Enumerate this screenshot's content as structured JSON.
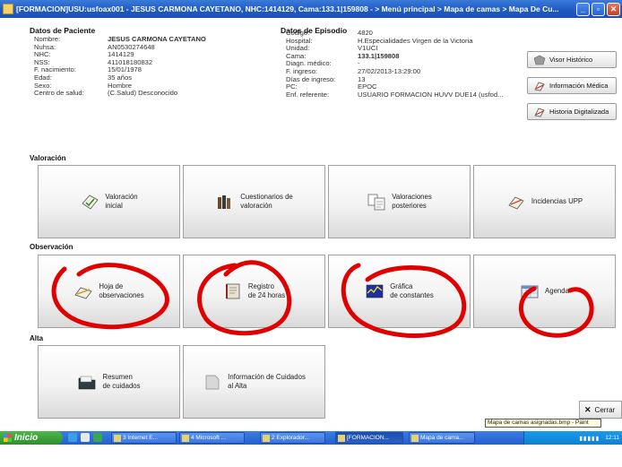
{
  "window": {
    "title": "[FORMACION]USU:usfoax001 - JESUS CARMONA CAYETANO, NHC:1414129, Cama:133.1|159808 - > Menú principal > Mapa de camas > Mapa De Cu...",
    "min_symbol": "_",
    "max_symbol": "▫",
    "close_symbol": "✕"
  },
  "patient": {
    "heading": "Datos de Paciente",
    "fields": [
      {
        "label": "Nombre:",
        "value": "JESUS CARMONA CAYETANO",
        "bold": true
      },
      {
        "label": "Nuhsa:",
        "value": "AN0530274648"
      },
      {
        "label": "NHC:",
        "value": "1414129"
      },
      {
        "label": "NSS:",
        "value": "411018180832"
      },
      {
        "label": "F. nacimiento:",
        "value": "15/01/1978"
      },
      {
        "label": "Edad:",
        "value": "35 años"
      },
      {
        "label": "Sexo:",
        "value": "Hombre"
      },
      {
        "label": "Centro de salud:",
        "value": "(C.Salud) Desconocido"
      }
    ]
  },
  "episode": {
    "heading": "Datos de Episodio",
    "fields": [
      {
        "label": "Codigo:",
        "value": "4820"
      },
      {
        "label": "Hospital:",
        "value": "H.Especialidades Virgen de la Victoria"
      },
      {
        "label": "Unidad:",
        "value": "V1UCI"
      },
      {
        "label": "Cama:",
        "value": "133.1|159808",
        "bold": true
      },
      {
        "label": "Diagn. médico:",
        "value": "-"
      },
      {
        "label": "F. ingreso:",
        "value": "27/02/2013-13:29:00"
      },
      {
        "label": "Días de ingreso:",
        "value": "13"
      },
      {
        "label": "PC:",
        "value": "EPOC"
      },
      {
        "label": "Enf. referente:",
        "value": "USUARIO FORMACION HUVV DUE14 (usfod..."
      }
    ]
  },
  "side_buttons": {
    "visor": "Visor Histórico",
    "info": "Información Médica",
    "historia": "Historia Digitalizada"
  },
  "sections": {
    "valoracion": "Valoración",
    "observacion": "Observación",
    "alta": "Alta"
  },
  "tiles": {
    "valoracion_inicial": "Valoración\ninicial",
    "cuestionarios": "Cuestionarios de\nvaloración",
    "valoraciones_posteriores": "Valoraciones\nposteriores",
    "incidencias_upp": "Incidencias UPP",
    "hoja_observaciones": "Hoja de\nobservaciones",
    "registro_24h": "Registro\nde 24 horas",
    "grafica_constantes": "Gráfica\nde constantes",
    "agenda": "Agenda",
    "resumen_cuidados": "Resumen\nde cuidados",
    "info_cuidados_alta": "Información de Cuidados\nal Alta"
  },
  "footer": {
    "cerrar": "Cerrar",
    "tooltip": "Mapa de camas asignadas.bmp - Paint"
  },
  "taskbar": {
    "start": "Inicio",
    "tasks": [
      "3 Internet E...",
      "4 Microsoft ...",
      "2 Explorador...",
      "[FORMACION...",
      "Mapa de cama..."
    ],
    "clock": "12:11"
  },
  "colors": {
    "annotation": "#e00000",
    "titlebar": "#1f5bc4"
  }
}
